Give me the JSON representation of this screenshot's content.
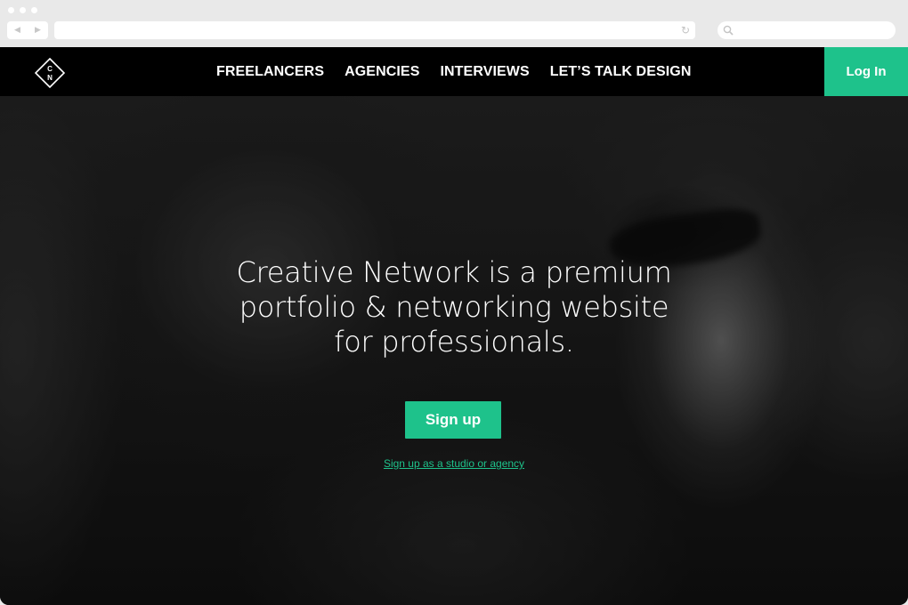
{
  "browser": {
    "back_glyph": "◀",
    "forward_glyph": "▶",
    "reload_glyph": "↻",
    "search_icon": "search-icon"
  },
  "colors": {
    "accent": "#1ec28b",
    "nav_bg": "#000000",
    "text": "#ffffff"
  },
  "logo": {
    "letter_top": "C",
    "letter_bottom": "N"
  },
  "nav": {
    "items": [
      {
        "label": "FREELANCERS"
      },
      {
        "label": "AGENCIES"
      },
      {
        "label": "INTERVIEWS"
      },
      {
        "label": "LET’S TALK DESIGN"
      }
    ],
    "login_label": "Log In"
  },
  "hero": {
    "headline_lines": [
      "Creative Network is a premium",
      "portfolio & networking website",
      "for professionals."
    ],
    "signup_label": "Sign up",
    "studio_link": "Sign up as a studio or agency"
  }
}
